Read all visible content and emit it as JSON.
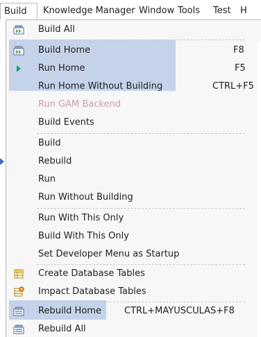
{
  "menubar": {
    "items": [
      "Build",
      "Knowledge Manager",
      "Window",
      "Tools",
      "Test",
      "H"
    ]
  },
  "menu": {
    "build_all": "Build All",
    "build_home": {
      "label": "Build Home",
      "shortcut": "F8"
    },
    "run_home": {
      "label": "Run Home",
      "shortcut": "F5"
    },
    "run_home_wo": {
      "label": "Run Home Without Building",
      "shortcut": "CTRL+F5"
    },
    "run_gam_backend": "Run GAM Backend",
    "build_events": "Build Events",
    "build": "Build",
    "rebuild": "Rebuild",
    "run": "Run",
    "run_without_building": "Run Without Building",
    "run_with_this_only": "Run With This Only",
    "build_with_this_only": "Build With This Only",
    "set_dev_menu": "Set Developer Menu as Startup",
    "create_db_tables": "Create Database Tables",
    "impact_db_tables": "Impact Database Tables",
    "rebuild_home": {
      "label": "Rebuild Home",
      "shortcut": "CTRL+MAYUSCULAS+F8"
    },
    "rebuild_all": "Rebuild All"
  },
  "colors": {
    "highlight": "#c5d3ea",
    "disabled_text": "#c6a0a6",
    "run_arrow": "#1e9b6b",
    "accent_blue": "#3d6fb6"
  },
  "icons": {
    "build_all": "build-all-icon",
    "build_home": "build-home-icon",
    "run_home": "run-arrow-icon",
    "create_db": "create-database-icon",
    "impact_db": "impact-database-icon",
    "rebuild_home": "rebuild-home-icon",
    "rebuild_all": "rebuild-all-icon"
  }
}
